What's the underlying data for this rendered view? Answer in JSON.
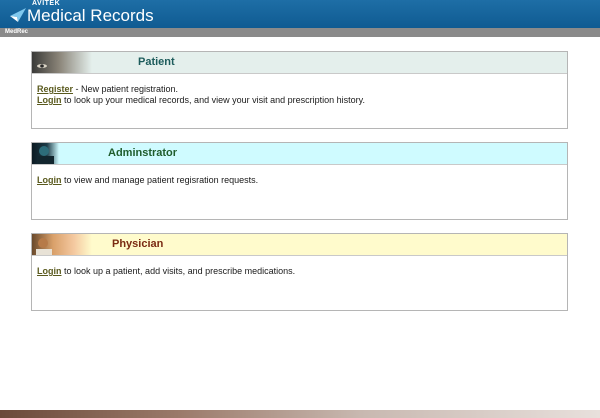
{
  "header": {
    "brand": "AVITEK",
    "title": "Medical Records",
    "sub_label": "MedRec"
  },
  "colors": {
    "header_bg": "#0f5b92",
    "patient_head_bg": "#e4efec",
    "admin_head_bg": "#cffbff",
    "physician_head_bg": "#fffbcc",
    "patient_title": "#1d5c5c",
    "admin_title": "#1f5c2c",
    "physician_title": "#7a2a12",
    "link": "#5a5a1e"
  },
  "patient": {
    "title": "Patient",
    "line1_link": "Register",
    "line1_text": " - New patient registration.",
    "line2_link": "Login",
    "line2_text": " to look up your medical records, and view your visit and prescription history."
  },
  "admin": {
    "title": "Adminstrator",
    "line1_link": "Login",
    "line1_text": " to view and manage patient regisration requests."
  },
  "physician": {
    "title": "Physician",
    "line1_link": "Login",
    "line1_text": " to look up a patient, add visits, and prescribe medications."
  }
}
